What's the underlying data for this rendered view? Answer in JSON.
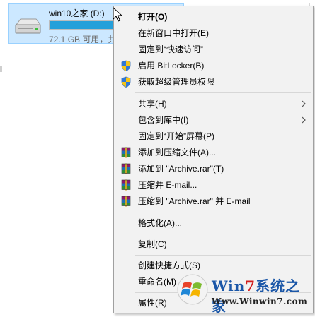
{
  "drive": {
    "name": "win10之家 (D:)",
    "free_text": "72.1 GB 可用，共",
    "used_fraction": 0.48,
    "bar_color": "#26a0da",
    "tile_bg": "#cce8ff",
    "icon": "hard-drive-icon"
  },
  "menu": {
    "items": [
      {
        "label": "打开(O)"
      },
      {
        "label": "在新窗口中打开(E)"
      },
      {
        "label": "固定到“快速访问”"
      },
      {
        "label": "启用 BitLocker(B)",
        "icon": "uac-shield-icon"
      },
      {
        "label": "获取超级管理员权限",
        "icon": "uac-shield-icon"
      },
      {
        "label": "共享(H)",
        "icon": "submenu-arrow-icon"
      },
      {
        "label": "包含到库中(I)",
        "icon": "submenu-arrow-icon"
      },
      {
        "label": "固定到“开始”屏幕(P)"
      },
      {
        "label": "添加到压缩文件(A)...",
        "icon": "winrar-icon"
      },
      {
        "label": "添加到 \"Archive.rar\"(T)",
        "icon": "winrar-icon"
      },
      {
        "label": "压缩并 E-mail...",
        "icon": "winrar-icon"
      },
      {
        "label": "压缩到 \"Archive.rar\" 并 E-mail",
        "icon": "winrar-icon"
      },
      {
        "label": "格式化(A)..."
      },
      {
        "label": "复制(C)"
      },
      {
        "label": "创建快捷方式(S)"
      },
      {
        "label": "重命名(M)"
      },
      {
        "label": "属性(R)"
      }
    ]
  },
  "watermark": {
    "brand_prefix": "Win",
    "brand_seven": "7",
    "brand_suffix": "系统之家",
    "url": "Www.Winwin7.com"
  },
  "colors": {
    "menu_bg": "#f2f2f2",
    "separator": "#d7d7d7",
    "brand_blue": "#1b57a8",
    "brand_red": "#d11f1f"
  }
}
